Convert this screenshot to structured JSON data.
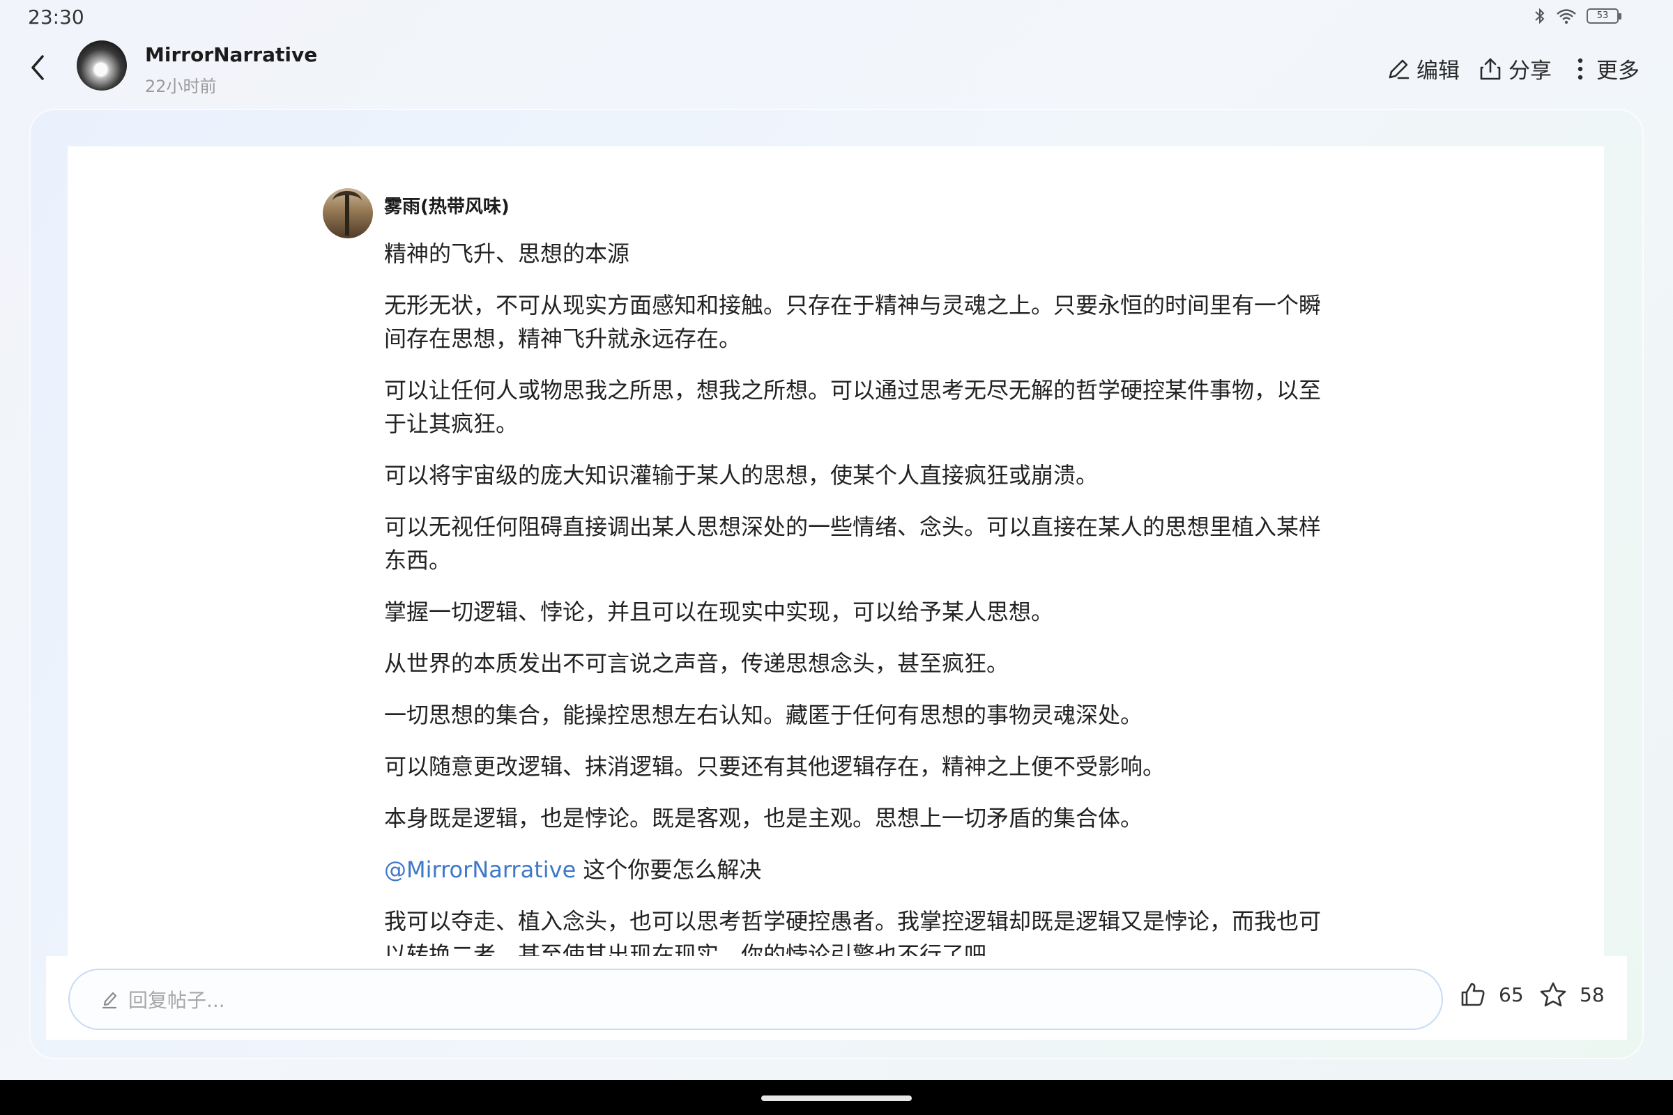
{
  "status_bar": {
    "time": "23:30",
    "battery_level": "53",
    "icons": [
      "bluetooth-icon",
      "wifi-icon",
      "battery-icon"
    ]
  },
  "header": {
    "author_name": "MirrorNarrative",
    "post_time": "22小时前",
    "actions": {
      "edit_label": "编辑",
      "share_label": "分享",
      "more_label": "更多"
    }
  },
  "comment": {
    "username": "雾雨(热带风味)",
    "paragraphs": [
      "精神的飞升、思想的本源",
      "无形无状，不可从现实方面感知和接触。只存在于精神与灵魂之上。只要永恒的时间里有一个瞬间存在思想，精神飞升就永远存在。",
      "可以让任何人或物思我之所思，想我之所想。可以通过思考无尽无解的哲学硬控某件事物，以至于让其疯狂。",
      "可以将宇宙级的庞大知识灌输于某人的思想，使某个人直接疯狂或崩溃。",
      "可以无视任何阻碍直接调出某人思想深处的一些情绪、念头。可以直接在某人的思想里植入某样东西。",
      "掌握一切逻辑、悖论，并且可以在现实中实现，可以给予某人思想。",
      "从世界的本质发出不可言说之声音，传递思想念头，甚至疯狂。",
      "一切思想的集合，能操控思想左右认知。藏匿于任何有思想的事物灵魂深处。",
      "可以随意更改逻辑、抹消逻辑。只要还有其他逻辑存在，精神之上便不受影响。",
      "本身既是逻辑，也是悖论。既是客观，也是主观。思想上一切矛盾的集合体。"
    ],
    "mention": "@MirrorNarrative",
    "mention_text": " 这个你要怎么解决",
    "last_paragraph": "我可以夺走、植入念头，也可以思考哲学硬控愚者。我掌控逻辑却既是逻辑又是悖论，而我也可以转换二者，甚至使其出现在现实，你的悖论引擎也不行了吧。"
  },
  "reply_bar": {
    "placeholder": "回复帖子...",
    "like_count": "65",
    "favorite_count": "58"
  },
  "colors": {
    "mention": "#3e78c8",
    "input_border": "#c9dcf2",
    "background": "#f1f4fa"
  }
}
